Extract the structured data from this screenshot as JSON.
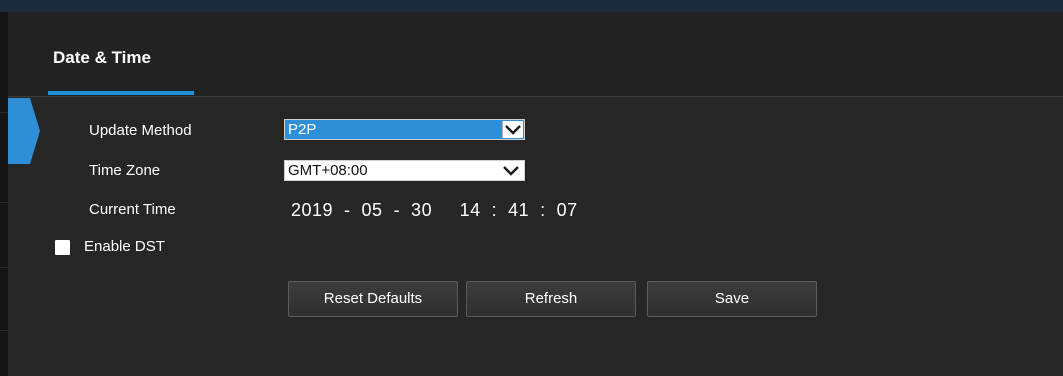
{
  "header": {
    "title": "Date & Time"
  },
  "form": {
    "update_method": {
      "label": "Update Method",
      "value": "P2P"
    },
    "time_zone": {
      "label": "Time Zone",
      "value": "GMT+08:00"
    },
    "current_time": {
      "label": "Current Time",
      "value": "2019  -  05  -  30     14  :  41  :  07"
    },
    "dst": {
      "label": "Enable DST",
      "checked": false
    }
  },
  "buttons": {
    "reset": "Reset Defaults",
    "refresh": "Refresh",
    "save": "Save"
  },
  "colors": {
    "accent": "#1e90d8",
    "background": "#262626",
    "header_background": "#222222",
    "selected_field": "#2e8fd6"
  }
}
